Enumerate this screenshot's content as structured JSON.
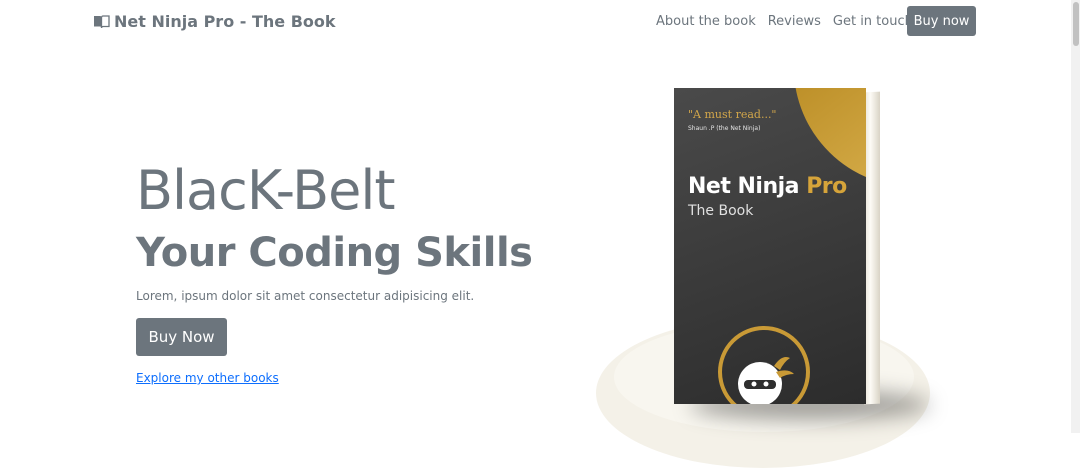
{
  "navbar": {
    "brand": "Net Ninja Pro - The Book",
    "brand_icon": "book-icon",
    "links": [
      "About the book",
      "Reviews",
      "Get in touch"
    ],
    "cta": "Buy now"
  },
  "hero": {
    "title": "BlacK-Belt",
    "subtitle": "Your Coding Skills",
    "lead": "Lorem, ipsum dolor sit amet consectetur adipisicing elit.",
    "button": "Buy Now",
    "link": "Explore my other books"
  },
  "book": {
    "quote": "\"A must read...\"",
    "author": "Shaun .P (the Net Ninja)",
    "title_main": "Net Ninja",
    "title_accent": "Pro",
    "subtitle": "The Book"
  },
  "colors": {
    "primary_gray": "#6c757d",
    "link_blue": "#0d6efd",
    "gold": "#c99a36"
  }
}
